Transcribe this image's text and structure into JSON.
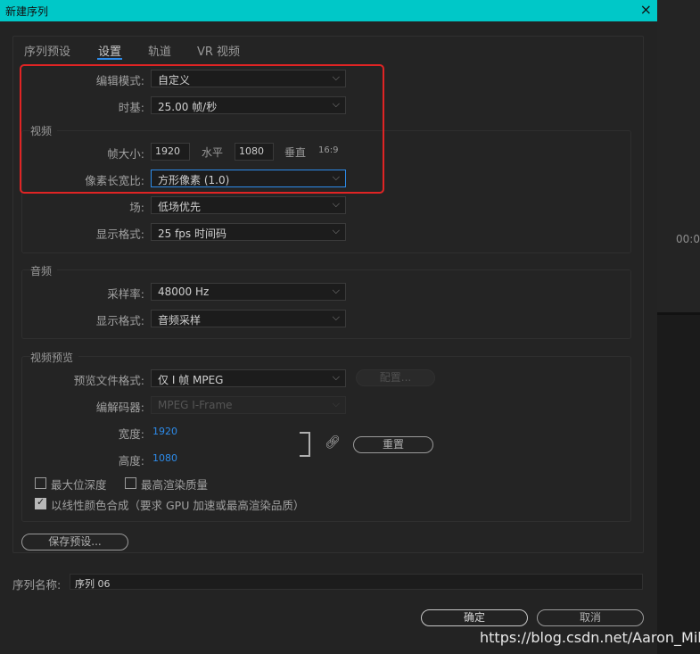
{
  "window": {
    "title": "新建序列",
    "close_icon": "×"
  },
  "right_panel": {
    "time_fragment": "00:0"
  },
  "tabs": [
    {
      "label": "序列预设",
      "active": false
    },
    {
      "label": "设置",
      "active": true
    },
    {
      "label": "轨道",
      "active": false
    },
    {
      "label": "VR 视频",
      "active": false
    }
  ],
  "general": {
    "edit_mode_label": "编辑模式:",
    "edit_mode_value": "自定义",
    "timebase_label": "时基:",
    "timebase_value": "25.00  帧/秒"
  },
  "video": {
    "title": "视频",
    "frame_size_label": "帧大小:",
    "width_value": "1920",
    "horizontal_label": "水平",
    "height_value": "1080",
    "vertical_label": "垂直",
    "aspect": "16:9",
    "pixel_aspect_label": "像素长宽比:",
    "pixel_aspect_value": "方形像素 (1.0)",
    "field_label": "场:",
    "field_value": "低场优先",
    "display_format_label": "显示格式:",
    "display_format_value": "25 fps 时间码"
  },
  "audio": {
    "title": "音频",
    "sample_rate_label": "采样率:",
    "sample_rate_value": "48000 Hz",
    "display_format_label": "显示格式:",
    "display_format_value": "音频采样"
  },
  "preview": {
    "title": "视频预览",
    "file_format_label": "预览文件格式:",
    "file_format_value": "仅 I 帧 MPEG",
    "config_button": "配置...",
    "codec_label": "编解码器:",
    "codec_value": "MPEG I-Frame",
    "width_label": "宽度:",
    "width_value": "1920",
    "height_label": "高度:",
    "height_value": "1080",
    "reset_button": "重置",
    "max_depth_label": "最大位深度",
    "max_depth_checked": false,
    "max_quality_label": "最高渲染质量",
    "max_quality_checked": false,
    "linear_color_label": "以线性颜色合成（要求 GPU 加速或最高渲染品质）",
    "linear_color_checked": true
  },
  "save_preset_button": "保存预设...",
  "sequence_name_label": "序列名称:",
  "sequence_name_value": "序列 06",
  "ok_button": "确定",
  "cancel_button": "取消",
  "watermark": "https://blog.csdn.net/Aaron_Miller",
  "colors": {
    "titlebar": "#00c8c8",
    "accent": "#2d8ceb",
    "highlight": "#e02424"
  }
}
